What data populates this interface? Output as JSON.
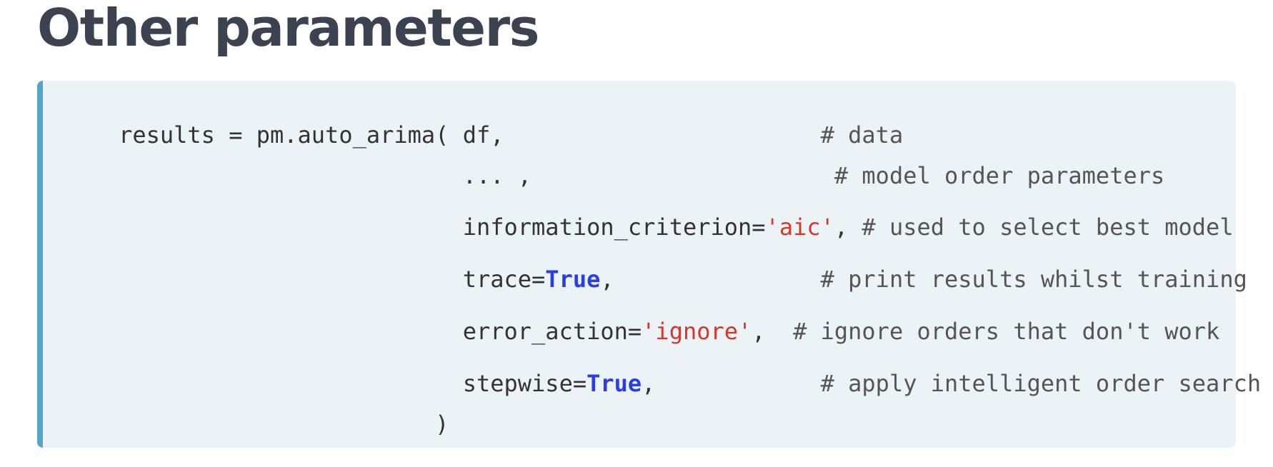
{
  "page": {
    "title": "Other parameters"
  },
  "code": {
    "lines": [
      [
        {
          "text": "results = pm.auto_arima( df,",
          "kind": "plain"
        },
        {
          "text": "                       # data",
          "kind": "comment"
        }
      ],
      [
        {
          "text": "                         ... ,",
          "kind": "plain"
        },
        {
          "text": "                      # model order parameters",
          "kind": "comment"
        }
      ],
      [
        {
          "text": "                         information_criterion=",
          "kind": "plain"
        },
        {
          "text": "'aic'",
          "kind": "string"
        },
        {
          "text": ",",
          "kind": "plain"
        },
        {
          "text": " # used to select best model",
          "kind": "comment"
        }
      ],
      [
        {
          "text": "                         trace=",
          "kind": "plain"
        },
        {
          "text": "True",
          "kind": "keyword"
        },
        {
          "text": ",",
          "kind": "plain"
        },
        {
          "text": "               # print results whilst training",
          "kind": "comment"
        }
      ],
      [
        {
          "text": "                         error_action=",
          "kind": "plain"
        },
        {
          "text": "'ignore'",
          "kind": "string"
        },
        {
          "text": ",",
          "kind": "plain"
        },
        {
          "text": "  # ignore orders that don't work",
          "kind": "comment"
        }
      ],
      [
        {
          "text": "                         stepwise=",
          "kind": "plain"
        },
        {
          "text": "True",
          "kind": "keyword"
        },
        {
          "text": ",",
          "kind": "plain"
        },
        {
          "text": "            # apply intelligent order search",
          "kind": "comment"
        }
      ],
      [
        {
          "text": "                       )",
          "kind": "plain"
        }
      ]
    ]
  }
}
